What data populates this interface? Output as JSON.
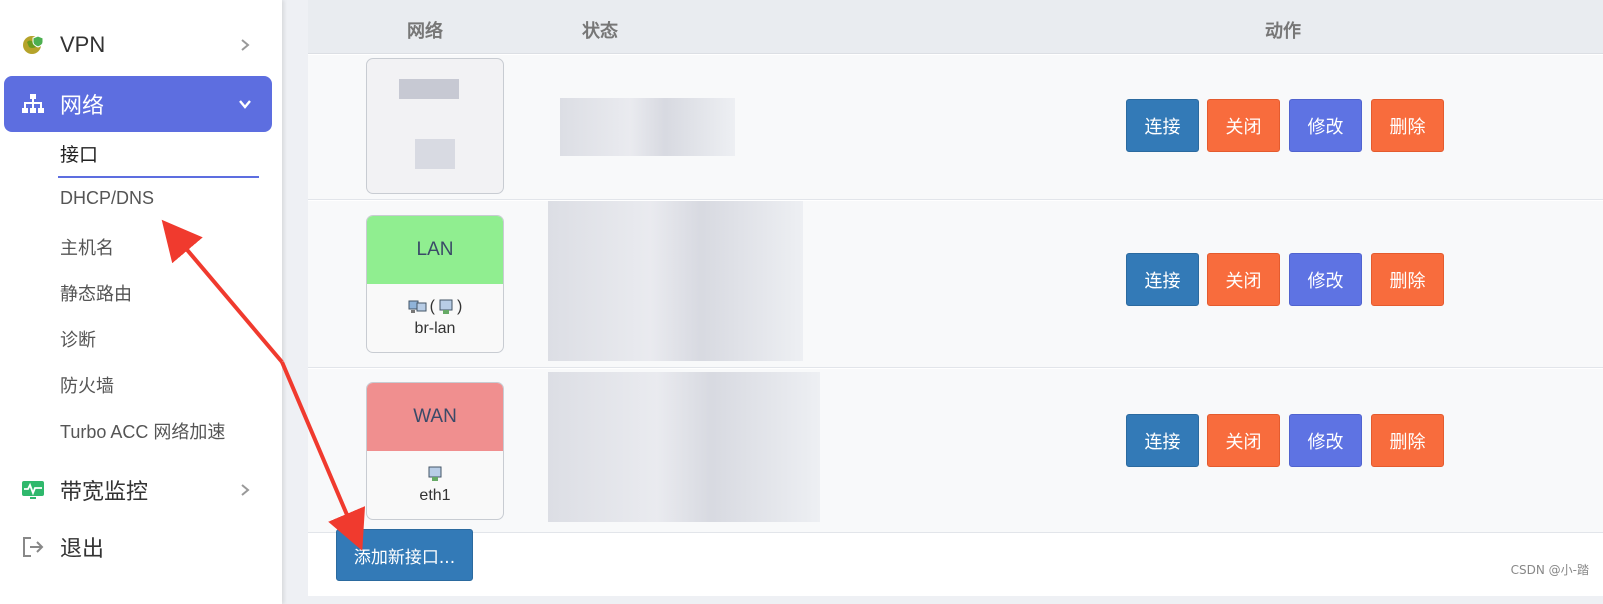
{
  "sidebar": {
    "vpn_label": "VPN",
    "network_label": "网络",
    "sub_items": [
      "接口",
      "DHCP/DNS",
      "主机名",
      "静态路由",
      "诊断",
      "防火墙",
      "Turbo ACC 网络加速"
    ],
    "bandwidth_label": "带宽监控",
    "logout_label": "退出"
  },
  "table": {
    "headers": {
      "network": "网络",
      "status": "状态",
      "actions": "动作"
    },
    "rows": [
      {
        "name": "",
        "device": ""
      },
      {
        "name": "LAN",
        "device": "br-lan",
        "icon_text": "(",
        "icon_text2": ")"
      },
      {
        "name": "WAN",
        "device": "eth1"
      }
    ],
    "buttons": {
      "connect": "连接",
      "close": "关闭",
      "edit": "修改",
      "delete": "删除"
    }
  },
  "add_button": "添加新接口...",
  "watermark": "CSDN @小-踏",
  "colors": {
    "accent": "#5d6ee0",
    "connect": "#337ab7",
    "close": "#f86c3d",
    "edit": "#5e73e3",
    "lan": "#90ee90",
    "wan": "#f08f8f",
    "annotation_arrow": "#f03a2e"
  }
}
